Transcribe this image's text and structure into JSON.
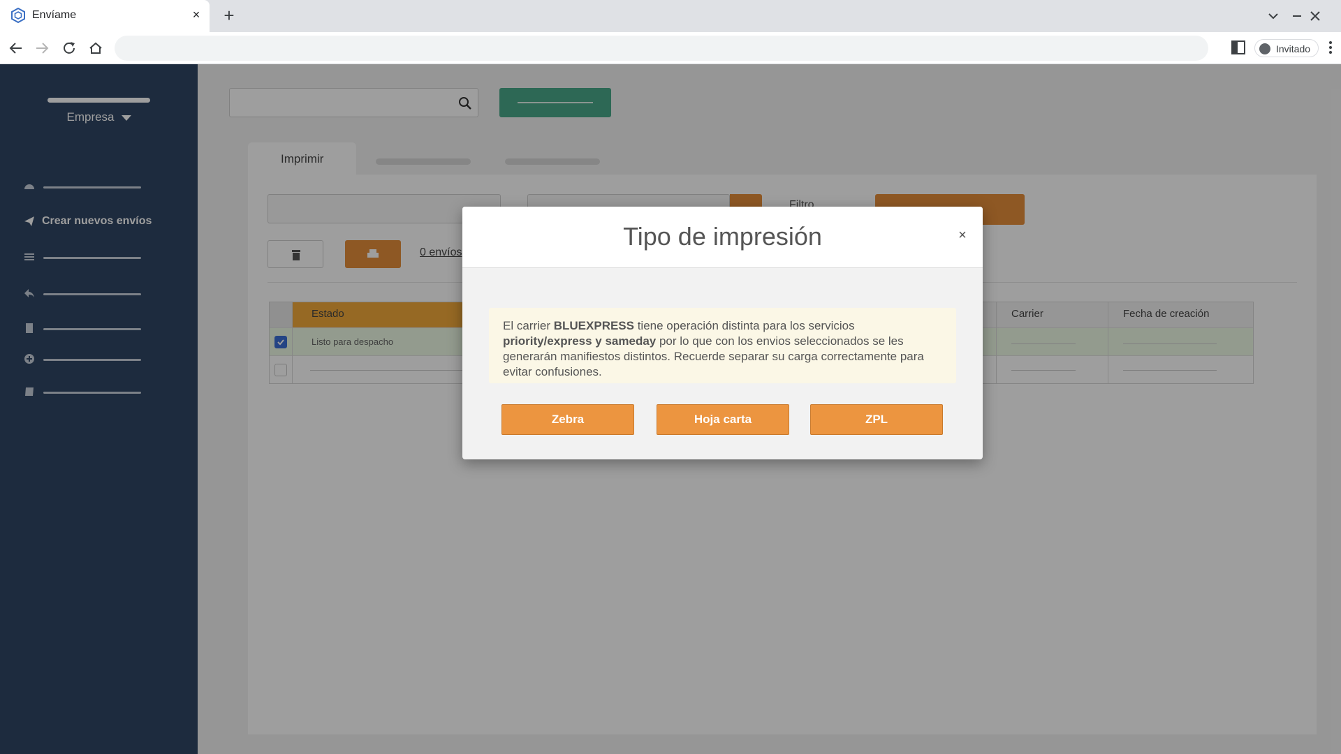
{
  "browser": {
    "tab_title": "Envíame",
    "tab_close": "×",
    "new_tab": "+",
    "profile_label": "Invitado"
  },
  "sidebar": {
    "company": "Empresa",
    "items": [
      {
        "icon": "dashboard-icon",
        "label": ""
      },
      {
        "icon": "paper-plane-icon",
        "label": "Crear nuevos envíos"
      },
      {
        "icon": "list-icon",
        "label": ""
      },
      {
        "icon": "reply-icon",
        "label": ""
      },
      {
        "icon": "receipt-icon",
        "label": ""
      },
      {
        "icon": "plus-circle-icon",
        "label": ""
      },
      {
        "icon": "book-icon",
        "label": ""
      }
    ]
  },
  "main": {
    "tabs": [
      {
        "label": "Imprimir"
      }
    ],
    "filter_label": "Filtro",
    "envios_count": "0 envíos",
    "table": {
      "headers": {
        "estado": "Estado",
        "carrier": "Carrier",
        "fecha": "Fecha de creación"
      },
      "rows": [
        {
          "checked": true,
          "estado": "Listo para despacho"
        },
        {
          "checked": false,
          "estado": ""
        }
      ]
    }
  },
  "modal": {
    "title": "Tipo de impresión",
    "close": "×",
    "notice": {
      "p1": "El carrier ",
      "carrier": "BLUEXPRESS",
      "p2": " tiene operación distinta para los servicios ",
      "services": "priority/express y sameday",
      "p3": " por lo que con los envios seleccionados se les generarán manifiestos distintos. Recuerde separar su carga correctamente para evitar confusiones."
    },
    "buttons": [
      "Zebra",
      "Hoja carta",
      "ZPL"
    ]
  },
  "colors": {
    "sidebar": "#2f4664",
    "accent_orange": "#ec9540",
    "teal": "#4aa98a",
    "notice_bg": "#fbf7e6"
  }
}
